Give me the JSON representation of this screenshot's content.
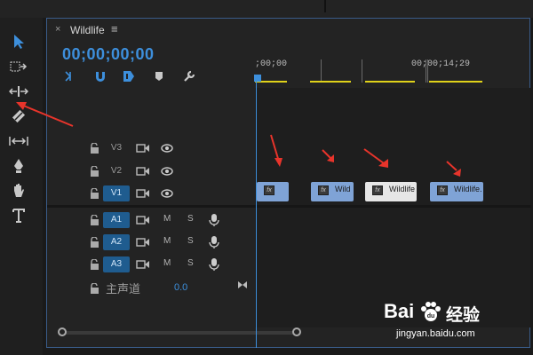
{
  "sequence": {
    "tab_title": "Wildlife",
    "close_glyph": "×",
    "menu_glyph": "≡",
    "timecode": "00;00;00;00"
  },
  "ruler": {
    "start_label": ";00;00",
    "mid_label": "00;00;14;29"
  },
  "tracks": {
    "video": [
      {
        "name": "V3"
      },
      {
        "name": "V2"
      },
      {
        "name": "V1",
        "active": true
      }
    ],
    "audio": [
      {
        "name": "A1",
        "mute": "M",
        "solo": "S"
      },
      {
        "name": "A2",
        "mute": "M",
        "solo": "S"
      },
      {
        "name": "A3",
        "mute": "M",
        "solo": "S"
      }
    ],
    "master": {
      "name": "主声道",
      "value": "0.0"
    }
  },
  "clips": [
    {
      "fx": "fx",
      "name": ""
    },
    {
      "fx": "fx",
      "name": "Wild"
    },
    {
      "fx": "fx",
      "name": "Wildlife"
    },
    {
      "fx": "fx",
      "name": "Wildlife."
    }
  ],
  "tools": [
    "selection-tool",
    "track-select-tool",
    "ripple-edit-tool",
    "razor-tool",
    "slip-tool",
    "pen-tool",
    "hand-tool",
    "type-tool"
  ],
  "watermark": {
    "brand_left": "Bai",
    "brand_right": "经验",
    "url": "jingyan.baidu.com"
  },
  "colors": {
    "accent": "#3d8fdc",
    "clip_blue": "#7fa3d6",
    "clip_white": "#e6e6e6",
    "track_active": "#1f5c8f",
    "workarea": "#e0d21a",
    "annotation_arrow": "#e8342b"
  }
}
